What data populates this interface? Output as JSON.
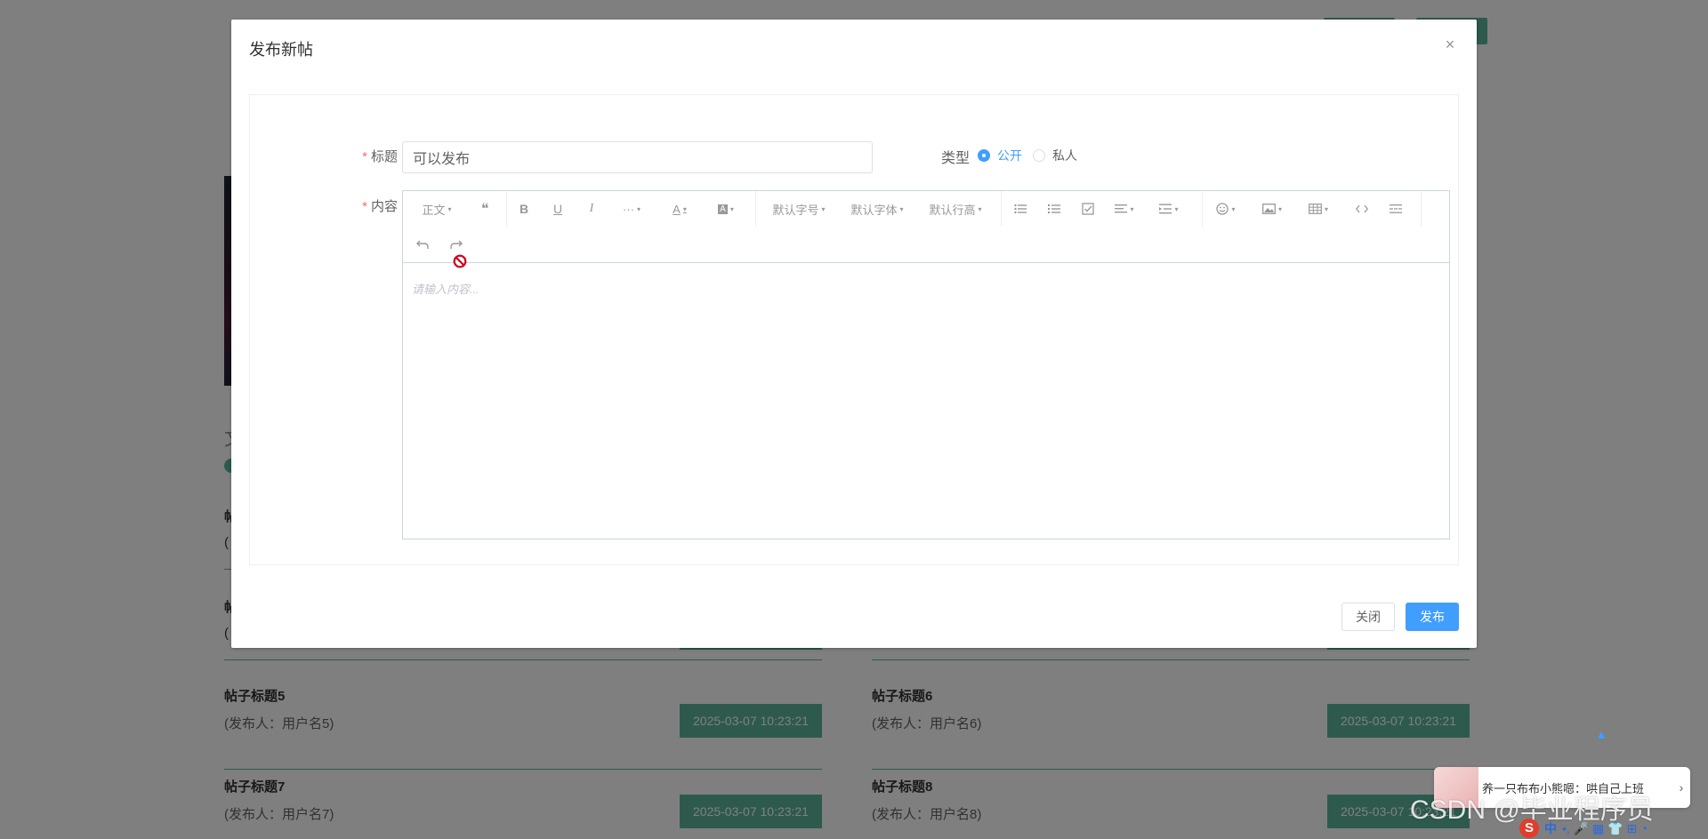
{
  "background": {
    "posts": [
      {
        "title": "帖子标题5",
        "author": "(发布人：用户名5)",
        "date": "2025-03-07 10:23:21"
      },
      {
        "title": "帖子标题6",
        "author": "(发布人：用户名6)",
        "date": "2025-03-07 10:23:21"
      },
      {
        "title": "帖子标题7",
        "author": "(发布人：用户名7)",
        "date": "2025-03-07 10:23:21"
      },
      {
        "title": "帖子标题8",
        "author": "(发布人：用户名8)",
        "date": "2025-03-07 10:23:21"
      }
    ],
    "fragments": {
      "a": "文",
      "b": "帖",
      "c": "(",
      "d": "帖",
      "e": "("
    }
  },
  "dialog": {
    "title": "发布新帖",
    "close_glyph": "×",
    "form": {
      "title_label": "标题",
      "title_value": "可以发布",
      "type_label": "类型",
      "type_options": [
        "公开",
        "私人"
      ],
      "type_selected": "公开",
      "content_label": "内容",
      "required_mark": "*"
    },
    "editor": {
      "placeholder": "请输入内容...",
      "toolbar": {
        "heading": "正文",
        "quote": "❝",
        "bold": "B",
        "underline": "U",
        "italic": "I",
        "more": "···",
        "font_color": "A",
        "bg_color": "A",
        "font_size": "默认字号",
        "font_family": "默认字体",
        "line_height": "默认行高",
        "caret": "▾"
      }
    },
    "buttons": {
      "close": "关闭",
      "publish": "发布"
    }
  },
  "widgets": {
    "ad_text": "养一只布布小熊嗯：哄自己上班",
    "ad_arrow": "›",
    "ad_close": "×",
    "watermark": "CSDN @毕业程序员",
    "ime_logo": "S",
    "ime_lang": "中",
    "ime_icons": "•, 🎤 ▦ 👕 ⊞ ◔",
    "scroll_top": "▲"
  },
  "colors": {
    "accent": "#409eff",
    "green": "#5bb59b",
    "danger": "#f56c6c"
  }
}
